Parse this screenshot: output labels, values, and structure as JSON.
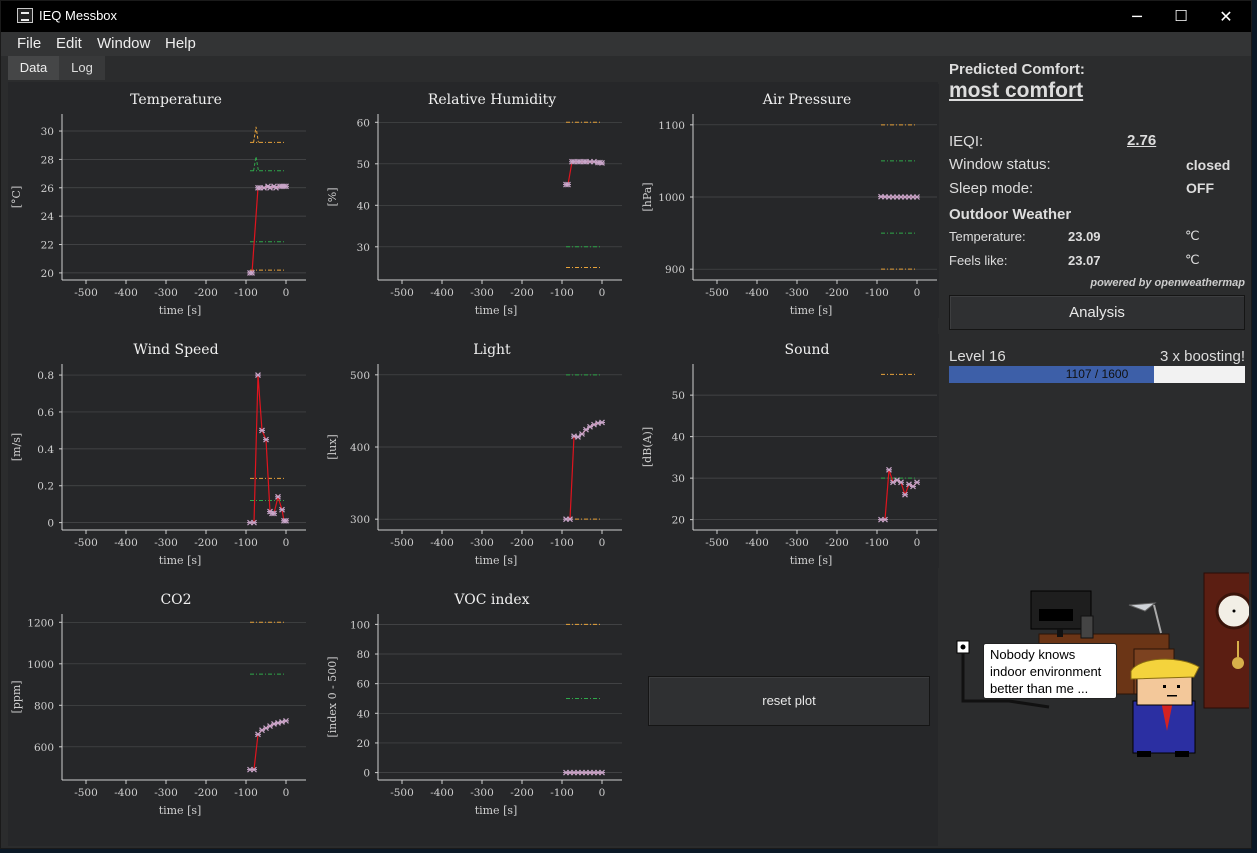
{
  "window": {
    "title": "IEQ Messbox",
    "minimize": "─",
    "maximize": "☐",
    "close": "✕"
  },
  "menu": [
    "File",
    "Edit",
    "Window",
    "Help"
  ],
  "tabs": [
    {
      "label": "Data",
      "active": true
    },
    {
      "label": "Log",
      "active": false
    }
  ],
  "plots": [
    {
      "title": "Temperature",
      "ylabel": "[°C]",
      "xlabel": "time [s]",
      "xlim": [
        -560,
        50
      ],
      "ylim": [
        19.5,
        31.2
      ],
      "xticks": [
        "-500",
        "-400",
        "-300",
        "-200",
        "-100",
        "0"
      ],
      "xtick_values": [
        -500,
        -400,
        -300,
        -200,
        -100,
        0
      ],
      "yticks": [
        "20",
        "22",
        "24",
        "26",
        "28",
        "30"
      ],
      "ytick_values": [
        20,
        22,
        24,
        26,
        28,
        30
      ],
      "series": [
        {
          "x": [
            -90,
            -85,
            -70,
            -65,
            -55,
            -45,
            -40,
            -30,
            -25,
            -15,
            -10,
            -5,
            0
          ],
          "y": [
            20.0,
            20.0,
            26.0,
            26.0,
            26.0,
            26.1,
            26.0,
            26.1,
            26.0,
            26.1,
            26.1,
            26.1,
            26.1
          ]
        }
      ],
      "bands": [
        {
          "y": 29.2,
          "color": "#e8a33a"
        },
        {
          "y": 27.2,
          "color": "#2fa84a"
        },
        {
          "y": 22.2,
          "color": "#2fa84a"
        },
        {
          "y": 20.2,
          "color": "#e8a33a"
        }
      ],
      "peaks": [
        {
          "x": -75,
          "y": 30.3,
          "base": 29.2,
          "color": "#e8a33a"
        },
        {
          "x": -75,
          "y": 28.2,
          "base": 27.2,
          "color": "#2fa84a"
        }
      ]
    },
    {
      "title": "Relative Humidity",
      "ylabel": "[%]",
      "xlabel": "time [s]",
      "xlim": [
        -560,
        50
      ],
      "ylim": [
        22,
        62
      ],
      "xticks": [
        "-500",
        "-400",
        "-300",
        "-200",
        "-100",
        "0"
      ],
      "xtick_values": [
        -500,
        -400,
        -300,
        -200,
        -100,
        0
      ],
      "yticks": [
        "30",
        "40",
        "50",
        "60"
      ],
      "ytick_values": [
        30,
        40,
        50,
        60
      ],
      "series": [
        {
          "x": [
            -90,
            -85,
            -75,
            -70,
            -60,
            -55,
            -45,
            -40,
            -30,
            -20,
            -10,
            -5,
            0
          ],
          "y": [
            45,
            45,
            50.5,
            50.5,
            50.5,
            50.5,
            50.5,
            50.5,
            50.5,
            50.5,
            50.3,
            50.3,
            50.2
          ]
        }
      ],
      "bands": [
        {
          "y": 60,
          "color": "#e8a33a"
        },
        {
          "y": 30,
          "color": "#2fa84a"
        },
        {
          "y": 25,
          "color": "#e8a33a"
        }
      ],
      "peaks": []
    },
    {
      "title": "Air Pressure",
      "ylabel": "[hPa]",
      "xlabel": "time [s]",
      "xlim": [
        -560,
        50
      ],
      "ylim": [
        885,
        1115
      ],
      "xticks": [
        "-500",
        "-400",
        "-300",
        "-200",
        "-100",
        "0"
      ],
      "xtick_values": [
        -500,
        -400,
        -300,
        -200,
        -100,
        0
      ],
      "yticks": [
        "900",
        "1000",
        "1100"
      ],
      "ytick_values": [
        900,
        1000,
        1100
      ],
      "series": [
        {
          "x": [
            -90,
            -80,
            -70,
            -60,
            -50,
            -40,
            -30,
            -20,
            -10,
            0
          ],
          "y": [
            1000.5,
            1000.3,
            1000,
            1000,
            1000,
            1000,
            1000,
            1000,
            1000,
            1000
          ]
        }
      ],
      "bands": [
        {
          "y": 1100,
          "color": "#e8a33a"
        },
        {
          "y": 1050,
          "color": "#2fa84a"
        },
        {
          "y": 950,
          "color": "#2fa84a"
        },
        {
          "y": 900,
          "color": "#e8a33a"
        }
      ],
      "peaks": []
    },
    {
      "title": "Wind Speed",
      "ylabel": "[m/s]",
      "xlabel": "time [s]",
      "xlim": [
        -560,
        50
      ],
      "ylim": [
        -0.04,
        0.86
      ],
      "xticks": [
        "-500",
        "-400",
        "-300",
        "-200",
        "-100",
        "0"
      ],
      "xtick_values": [
        -500,
        -400,
        -300,
        -200,
        -100,
        0
      ],
      "yticks": [
        "0",
        "0.2",
        "0.4",
        "0.6",
        "0.8"
      ],
      "ytick_values": [
        0,
        0.2,
        0.4,
        0.6,
        0.8
      ],
      "series": [
        {
          "x": [
            -90,
            -80,
            -70,
            -60,
            -50,
            -40,
            -35,
            -30,
            -20,
            -10,
            -5,
            0
          ],
          "y": [
            0,
            0,
            0.8,
            0.5,
            0.45,
            0.06,
            0.05,
            0.05,
            0.14,
            0.07,
            0.01,
            0.01
          ]
        }
      ],
      "bands": [
        {
          "y": 0.24,
          "color": "#e8a33a"
        },
        {
          "y": 0.12,
          "color": "#2fa84a"
        }
      ],
      "peaks": []
    },
    {
      "title": "Light",
      "ylabel": "[lux]",
      "xlabel": "time [s]",
      "xlim": [
        -560,
        50
      ],
      "ylim": [
        285,
        515
      ],
      "xticks": [
        "-500",
        "-400",
        "-300",
        "-200",
        "-100",
        "0"
      ],
      "xtick_values": [
        -500,
        -400,
        -300,
        -200,
        -100,
        0
      ],
      "yticks": [
        "300",
        "400",
        "500"
      ],
      "ytick_values": [
        300,
        400,
        500
      ],
      "series": [
        {
          "x": [
            -90,
            -80,
            -70,
            -60,
            -50,
            -40,
            -30,
            -20,
            -10,
            0
          ],
          "y": [
            300,
            300,
            415,
            414,
            418,
            424,
            428,
            431,
            433,
            434
          ]
        }
      ],
      "bands": [
        {
          "y": 500,
          "color": "#2fa84a"
        },
        {
          "y": 300,
          "color": "#e8a33a"
        }
      ],
      "peaks": []
    },
    {
      "title": "Sound",
      "ylabel": "[dB(A)]",
      "xlabel": "time [s]",
      "xlim": [
        -560,
        50
      ],
      "ylim": [
        17.5,
        57.5
      ],
      "xticks": [
        "-500",
        "-400",
        "-300",
        "-200",
        "-100",
        "0"
      ],
      "xtick_values": [
        -500,
        -400,
        -300,
        -200,
        -100,
        0
      ],
      "yticks": [
        "20",
        "30",
        "40",
        "50"
      ],
      "ytick_values": [
        20,
        30,
        40,
        50
      ],
      "series": [
        {
          "x": [
            -90,
            -80,
            -70,
            -60,
            -50,
            -40,
            -30,
            -20,
            -10,
            0
          ],
          "y": [
            20,
            20,
            32,
            29,
            29.5,
            29,
            26,
            28.5,
            28,
            29
          ]
        }
      ],
      "bands": [
        {
          "y": 55,
          "color": "#e8a33a"
        },
        {
          "y": 30,
          "color": "#2fa84a"
        }
      ],
      "peaks": []
    },
    {
      "title": "CO2",
      "ylabel": "[ppm]",
      "xlabel": "time [s]",
      "xlim": [
        -560,
        50
      ],
      "ylim": [
        440,
        1240
      ],
      "xticks": [
        "-500",
        "-400",
        "-300",
        "-200",
        "-100",
        "0"
      ],
      "xtick_values": [
        -500,
        -400,
        -300,
        -200,
        -100,
        0
      ],
      "yticks": [
        "600",
        "800",
        "1000",
        "1200"
      ],
      "ytick_values": [
        600,
        800,
        1000,
        1200
      ],
      "series": [
        {
          "x": [
            -90,
            -80,
            -70,
            -60,
            -50,
            -40,
            -30,
            -20,
            -10,
            0
          ],
          "y": [
            490,
            490,
            660,
            680,
            690,
            700,
            710,
            715,
            720,
            725
          ]
        }
      ],
      "bands": [
        {
          "y": 1200,
          "color": "#e8a33a"
        },
        {
          "y": 950,
          "color": "#2fa84a"
        }
      ],
      "peaks": []
    },
    {
      "title": "VOC index",
      "ylabel": "[index 0 - 500]",
      "xlabel": "time [s]",
      "xlim": [
        -560,
        50
      ],
      "ylim": [
        -5,
        107
      ],
      "xticks": [
        "-500",
        "-400",
        "-300",
        "-200",
        "-100",
        "0"
      ],
      "xtick_values": [
        -500,
        -400,
        -300,
        -200,
        -100,
        0
      ],
      "yticks": [
        "0",
        "20",
        "40",
        "60",
        "80",
        "100"
      ],
      "ytick_values": [
        0,
        20,
        40,
        60,
        80,
        100
      ],
      "series": [
        {
          "x": [
            -90,
            -80,
            -70,
            -60,
            -50,
            -40,
            -30,
            -20,
            -10,
            0
          ],
          "y": [
            0,
            0,
            0,
            0,
            0,
            0,
            0,
            0,
            0,
            0
          ]
        }
      ],
      "bands": [
        {
          "y": 100,
          "color": "#e8a33a"
        },
        {
          "y": 50,
          "color": "#2fa84a"
        }
      ],
      "peaks": []
    }
  ],
  "reset_button": "reset plot",
  "sidebar": {
    "predicted_label": "Predicted Comfort:",
    "predicted_value": "most comfort",
    "ieqi_label": "IEQI:",
    "ieqi_value": "2.76",
    "window_label": "Window status:",
    "window_value": "closed",
    "sleep_label": "Sleep mode:",
    "sleep_value": "OFF",
    "outdoor_heading": "Outdoor Weather",
    "temp_label": "Temperature:",
    "temp_value": "23.09",
    "temp_unit": "℃",
    "feels_label": "Feels like:",
    "feels_value": "23.07",
    "feels_unit": "℃",
    "powered": "powered by openweathermap",
    "analysis_button": "Analysis",
    "level": "Level 16",
    "boost": "3 x boosting!",
    "progress_text": "1107 / 1600",
    "progress_value": 1107,
    "progress_max": 1600
  },
  "speech_bubble": [
    "Nobody knows",
    "indoor environment",
    "better than me ..."
  ],
  "colors": {
    "line": "#e0141e",
    "marker": "#c9a6c9",
    "orange_band": "#e8a33a",
    "green_band": "#2fa84a",
    "progress_fill": "#3d5fa8"
  }
}
